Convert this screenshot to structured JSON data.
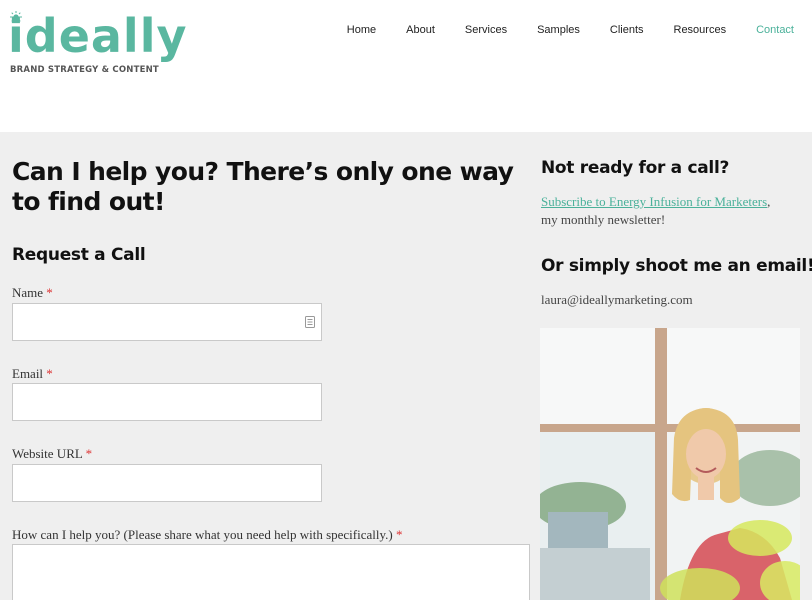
{
  "logo": {
    "word": "ideally",
    "tagline": "BRAND STRATEGY & CONTENT"
  },
  "nav": {
    "items": [
      "Home",
      "About",
      "Services",
      "Samples",
      "Clients",
      "Resources",
      "Contact"
    ],
    "active": "Contact"
  },
  "form": {
    "heading": "Can I help you? There’s only one way to find out!",
    "subheading": "Request a Call",
    "required_mark": "*",
    "fields": [
      {
        "label": "Name",
        "value": ""
      },
      {
        "label": "Email",
        "value": ""
      },
      {
        "label": "Website URL",
        "value": ""
      },
      {
        "label": "How can I help you? (Please share what you need help with specifically.)",
        "value": ""
      }
    ]
  },
  "sidebar": {
    "heading1": "Not ready for a call?",
    "newsletter_link": "Subscribe to Energy Infusion for Marketers",
    "newsletter_suffix": ",",
    "newsletter_text": "my monthly newsletter!",
    "heading2": "Or simply shoot me an email!",
    "email": "laura@ideallymarketing.com"
  },
  "colors": {
    "accent": "#4ab19a",
    "logo": "#5ab7a0",
    "background": "#efefef",
    "required": "#dd3333"
  },
  "icons": {
    "field_icon": "contact-card-icon",
    "logo_mark": "sun-icon"
  }
}
